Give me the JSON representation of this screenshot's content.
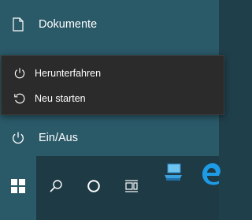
{
  "start_menu": {
    "documents_label": "Dokumente",
    "power_label": "Ein/Aus"
  },
  "power_flyout": {
    "shutdown_label": "Herunterfahren",
    "restart_label": "Neu starten"
  },
  "colors": {
    "menu_bg": "#2a5968",
    "flyout_bg": "#2b2b2b",
    "taskbar_bg": "#1e3a45",
    "accent": "#4cc2ff"
  }
}
